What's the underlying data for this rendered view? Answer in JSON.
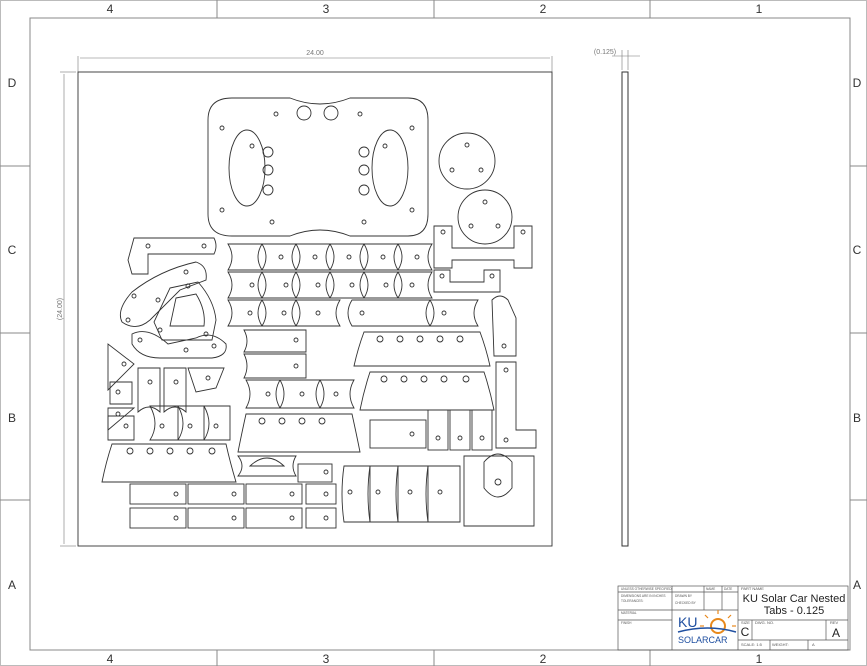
{
  "border": {
    "zones_top": [
      "4",
      "3",
      "2",
      "1"
    ],
    "zones_bottom": [
      "4",
      "3",
      "2",
      "1"
    ],
    "zones_left": [
      "D",
      "C",
      "B",
      "A"
    ],
    "zones_right": [
      "D",
      "C",
      "B",
      "A"
    ]
  },
  "dimensions": {
    "width": "24.00",
    "height": "(24.00)",
    "thickness": "(0.125)"
  },
  "title_block": {
    "tolerance_note": "UNLESS OTHERWISE SPECIFIED:",
    "dims_note": "DIMENSIONS ARE IN INCHES",
    "tolerances_label": "TOLERANCES:",
    "material_label": "MATERIAL",
    "finish_label": "FINISH",
    "name_label": "NAME",
    "date_label": "DATE",
    "drawn_label": "DRAWN BY",
    "checked_label": "CHECKED BY",
    "part_name_label": "PART NAME",
    "part_name_line1": "KU Solar Car Nested",
    "part_name_line2": "Tabs - 0.125",
    "size_label": "SIZE",
    "size_value": "C",
    "dwg_no_label": "DWG. NO.",
    "rev_label": "REV",
    "rev_value": "A",
    "scale_label": "SCALE: 1:5",
    "weight_label": "WEIGHT:",
    "sheet_value": "A",
    "logo_text_top": "KU",
    "logo_text_bottom": "SOLARCAR"
  },
  "colors": {
    "line": "#333333",
    "frame": "#666666",
    "logo_blue": "#1f4fa0",
    "logo_orange": "#e8891c"
  }
}
